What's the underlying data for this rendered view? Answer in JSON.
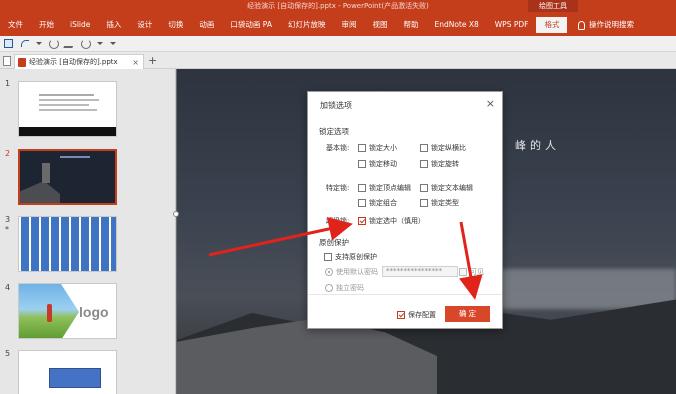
{
  "app": {
    "title": "经验演示 [自动保存的].pptx  -  PowerPoint(产品激活失败)",
    "contextual_group": "绘图工具",
    "tabs": [
      "文件",
      "开始",
      "iSlide",
      "插入",
      "设计",
      "切换",
      "动画",
      "口袋动画 PA",
      "幻灯片放映",
      "审阅",
      "视图",
      "帮助",
      "EndNote X8",
      "WPS PDF",
      "格式"
    ],
    "active_tab": "格式",
    "tell_me": "操作说明搜索"
  },
  "document": {
    "tab_name": "经验演示 [自动保存的].pptx",
    "close": "×",
    "add": "+"
  },
  "slides": {
    "numbers": [
      "1",
      "2",
      "3",
      "4",
      "5"
    ],
    "selected": "2",
    "star": "*",
    "thumb4_text": "logo"
  },
  "canvas": {
    "text": "峰的人"
  },
  "dialog": {
    "title": "加锁选项",
    "close": "×",
    "lock_section": "锁定选项",
    "basic_label": "基本锁:",
    "special_label": "特定锁:",
    "super_label": "超级锁:",
    "checkboxes": {
      "lock_size": "锁定大小",
      "lock_aspect": "锁定纵横比",
      "lock_move": "锁定移动",
      "lock_rotate": "锁定旋转",
      "lock_vertex": "锁定顶点编辑",
      "lock_text": "锁定文本编辑",
      "lock_group": "锁定组合",
      "lock_type": "锁定类型",
      "lock_select": "锁定选中（慎用）"
    },
    "checked": {
      "lock_select": true,
      "save_config": true
    },
    "protect_section": "原创保护",
    "support_protect": "支持原创保护",
    "use_default_pwd": "使用默认密码",
    "pwd_value": "****************",
    "visible": "可见",
    "separate_pwd": "独立密码",
    "save_config": "保存配置",
    "ok": "确 定"
  },
  "colors": {
    "ribbon": "#c43e1c",
    "accent": "#d9472b",
    "arrow": "#e0231b"
  }
}
